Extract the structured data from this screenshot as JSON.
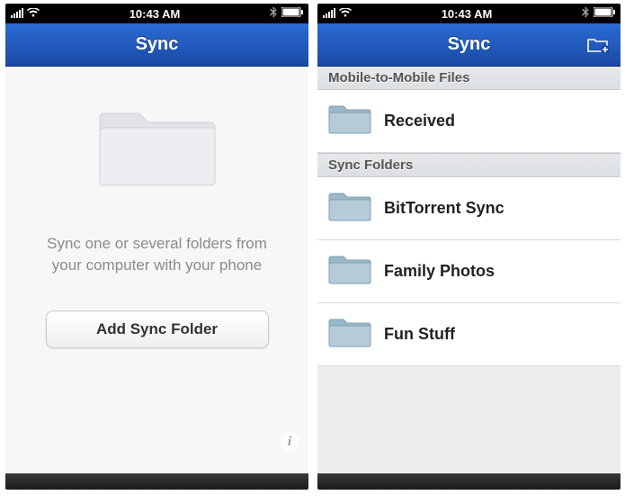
{
  "statusbar": {
    "time": "10:43 AM"
  },
  "navbar": {
    "title": "Sync"
  },
  "empty": {
    "text": "Sync one or several folders from your computer with your phone",
    "addButton": "Add Sync Folder",
    "info": "i"
  },
  "sections": {
    "mobile": {
      "header": "Mobile-to-Mobile Files",
      "items": [
        {
          "label": "Received"
        }
      ]
    },
    "folders": {
      "header": "Sync Folders",
      "items": [
        {
          "label": "BitTorrent Sync"
        },
        {
          "label": "Family Photos"
        },
        {
          "label": "Fun Stuff"
        }
      ]
    }
  }
}
